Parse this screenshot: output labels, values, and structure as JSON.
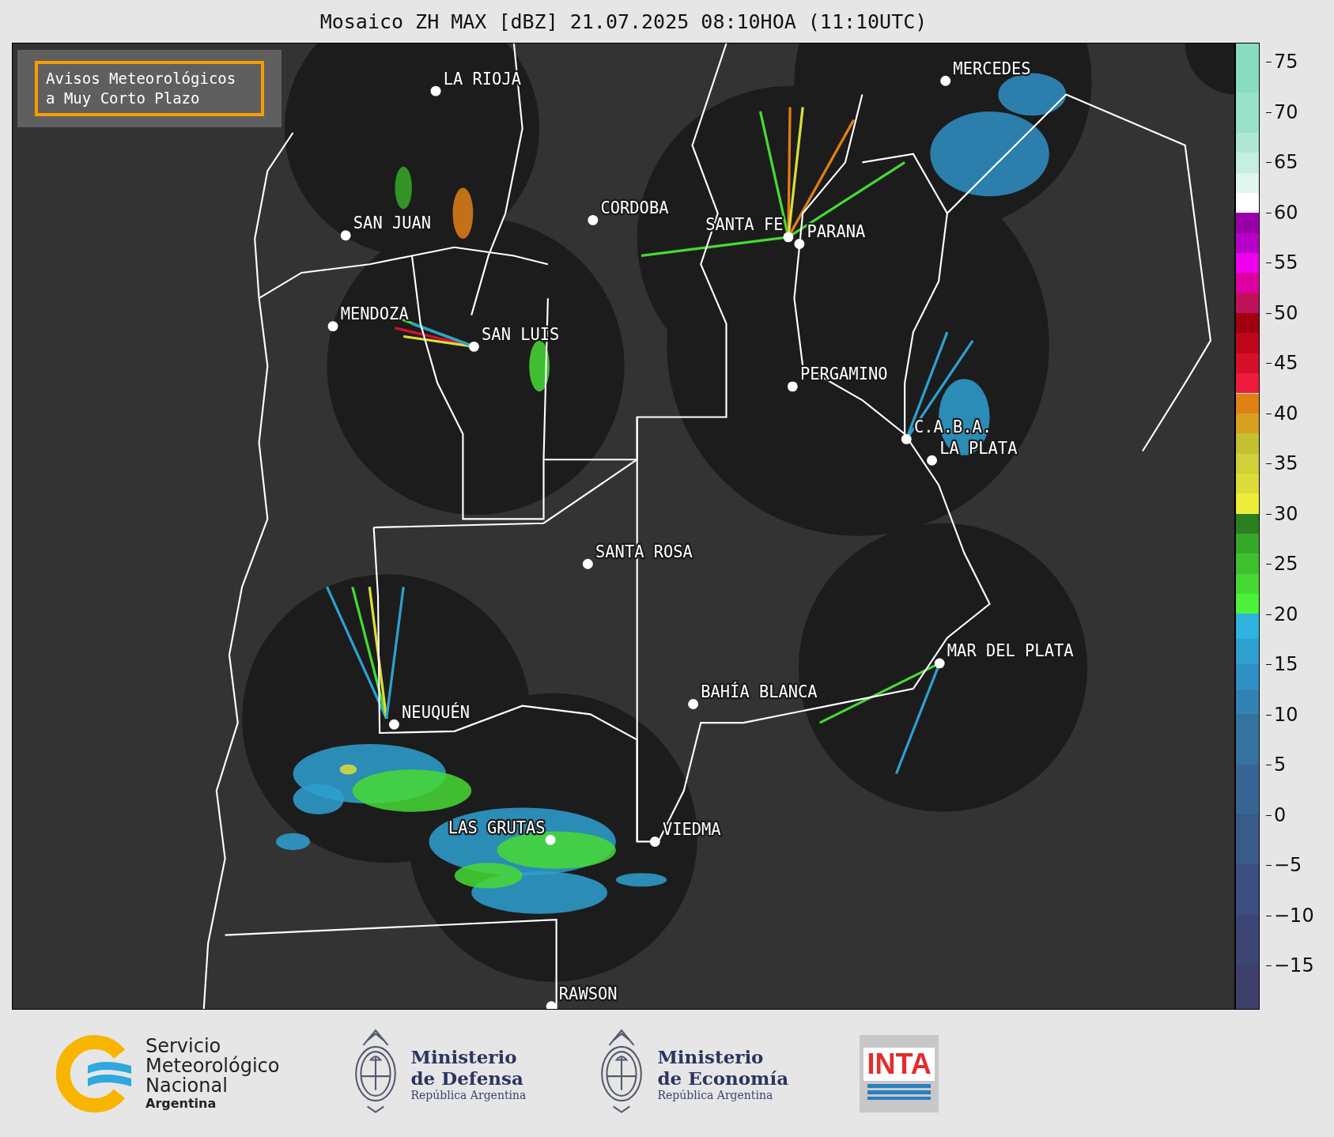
{
  "title": "Mosaico ZH MAX [dBZ] 21.07.2025 08:10HOA (11:10UTC)",
  "notice_box": {
    "lines": [
      "Avisos Meteorológicos",
      "a Muy Corto Plazo"
    ]
  },
  "cities": [
    "LA RIOJA",
    "SAN JUAN",
    "CORDOBA",
    "SANTA FE",
    "PARANA",
    "MERCEDES",
    "MENDOZA",
    "SAN LUIS",
    "PERGAMINO",
    "C.A.B.A.",
    "LA PLATA",
    "SANTA ROSA",
    "MAR DEL PLATA",
    "BAHÍA BLANCA",
    "NEUQUÉN",
    "LAS GRUTAS",
    "VIEDMA",
    "RAWSON"
  ],
  "colorbar": {
    "ticks": [
      "75",
      "70",
      "65",
      "60",
      "55",
      "50",
      "45",
      "40",
      "35",
      "30",
      "25",
      "20",
      "15",
      "10",
      "5",
      "0",
      "−5",
      "−10",
      "−15"
    ]
  },
  "footer": {
    "smn": {
      "lines": [
        "Servicio",
        "Meteorológico",
        "Nacional"
      ],
      "country": "Argentina"
    },
    "ministries": [
      {
        "lines": [
          "Ministerio",
          "de Defensa"
        ],
        "subtitle": "República Argentina"
      },
      {
        "lines": [
          "Ministerio",
          "de Economía"
        ],
        "subtitle": "República Argentina"
      }
    ],
    "inta": "INTA"
  }
}
